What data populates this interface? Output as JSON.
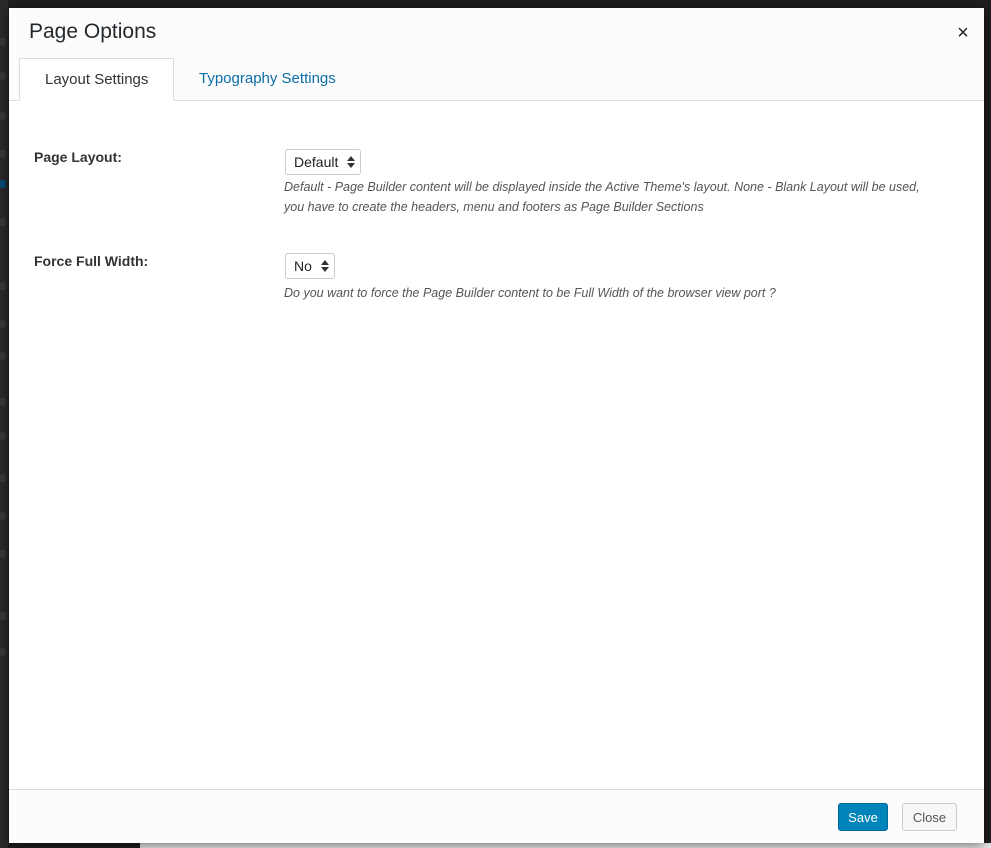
{
  "modal": {
    "title": "Page Options",
    "close_icon": "×"
  },
  "tabs": [
    {
      "label": "Layout Settings",
      "active": true
    },
    {
      "label": "Typography Settings",
      "active": false
    }
  ],
  "fields": {
    "page_layout": {
      "label": "Page Layout:",
      "value": "Default",
      "help": "Default - Page Builder content will be displayed inside the Active Theme's layout. None - Blank Layout will be used, you have to create the headers, menu and footers as Page Builder Sections"
    },
    "force_full_width": {
      "label": "Force Full Width:",
      "value": "No",
      "help": "Do you want to force the Page Builder content to be Full Width of the browser view port ?"
    }
  },
  "footer": {
    "save_label": "Save",
    "close_label": "Close"
  },
  "colors": {
    "primary": "#0085ba",
    "link": "#0b6ea8"
  }
}
